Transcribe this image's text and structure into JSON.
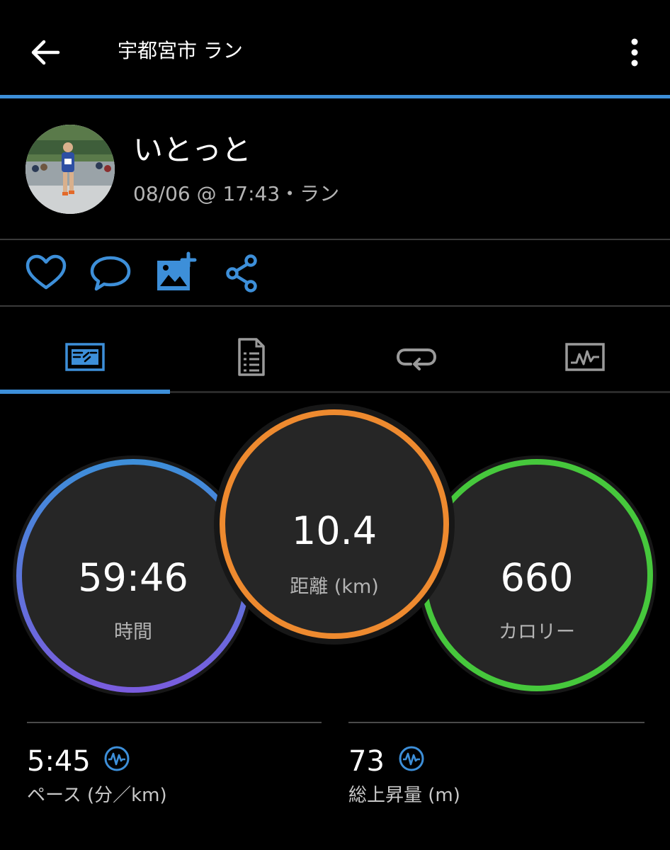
{
  "header": {
    "title": "宇都宮市 ラン",
    "back_icon": "arrow-left-icon",
    "more_icon": "more-vertical-icon",
    "accent_color": "#3d8fd9"
  },
  "profile": {
    "name": "いとっと",
    "meta": "08/06 @ 17:43・ラン"
  },
  "actions": [
    {
      "name": "like",
      "icon": "heart-icon"
    },
    {
      "name": "comment",
      "icon": "comment-icon"
    },
    {
      "name": "add-photo",
      "icon": "add-photo-icon"
    },
    {
      "name": "share",
      "icon": "share-icon"
    }
  ],
  "tabs": [
    {
      "name": "overview",
      "icon": "overview-card-icon",
      "selected": true
    },
    {
      "name": "stats",
      "icon": "document-list-icon",
      "selected": false
    },
    {
      "name": "laps",
      "icon": "loop-icon",
      "selected": false
    },
    {
      "name": "charts",
      "icon": "chart-icon",
      "selected": false
    }
  ],
  "stats": {
    "time": {
      "value": "59:46",
      "label": "時間",
      "ring_colors": [
        "#3d8fd9",
        "#7a5cde"
      ]
    },
    "distance": {
      "value": "10.4",
      "label": "距離 (km)",
      "ring_color": "#ee8a2f"
    },
    "calories": {
      "value": "660",
      "label": "カロリー",
      "ring_color": "#46c83c"
    }
  },
  "summary": {
    "pace": {
      "value": "5:45",
      "label": "ペース (分／km)",
      "icon": "activity-wave-icon"
    },
    "ascent": {
      "value": "73",
      "label": "総上昇量 (m)",
      "icon": "activity-wave-icon"
    }
  }
}
